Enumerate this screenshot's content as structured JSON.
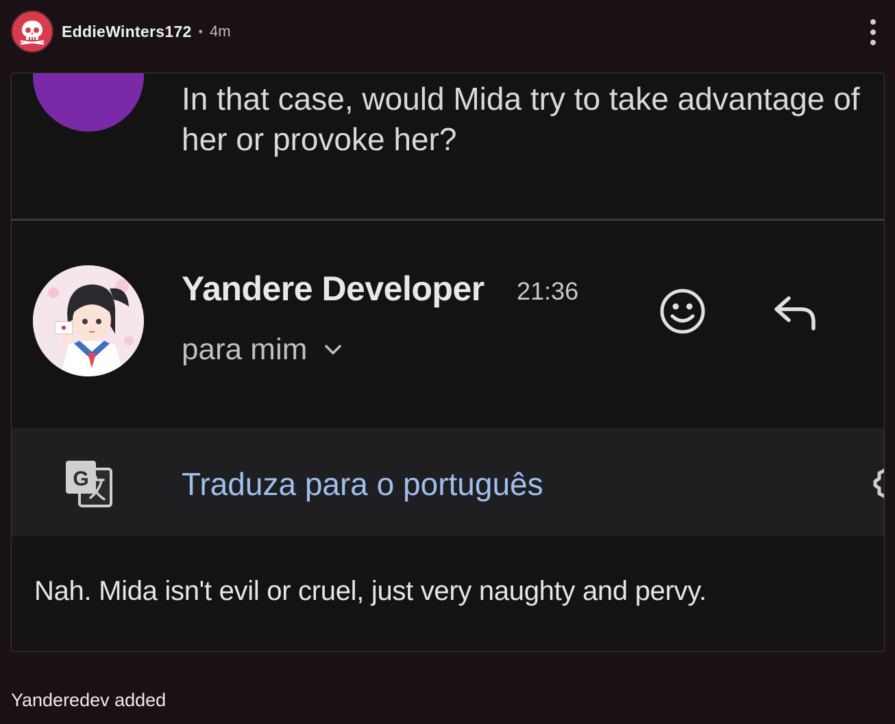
{
  "post": {
    "username": "EddieWinters172",
    "separator": "•",
    "time": "4m",
    "avatar_icon": "skull-icon",
    "accent_color": "#d93a4c",
    "caption": "Yanderedev added"
  },
  "screenshot": {
    "question": "In that case, would Mida try to take advantage of her or provoke her?",
    "sender_name": "Yandere Developer",
    "sender_time": "21:36",
    "recipient": "para mim",
    "translate_label": "Traduza para o português",
    "answer": "Nah. Mida isn't evil or cruel, just very naughty and pervy.",
    "icons": [
      "emoji-icon",
      "reply-icon",
      "translate-icon",
      "settings-icon",
      "chevron-down-icon"
    ]
  }
}
